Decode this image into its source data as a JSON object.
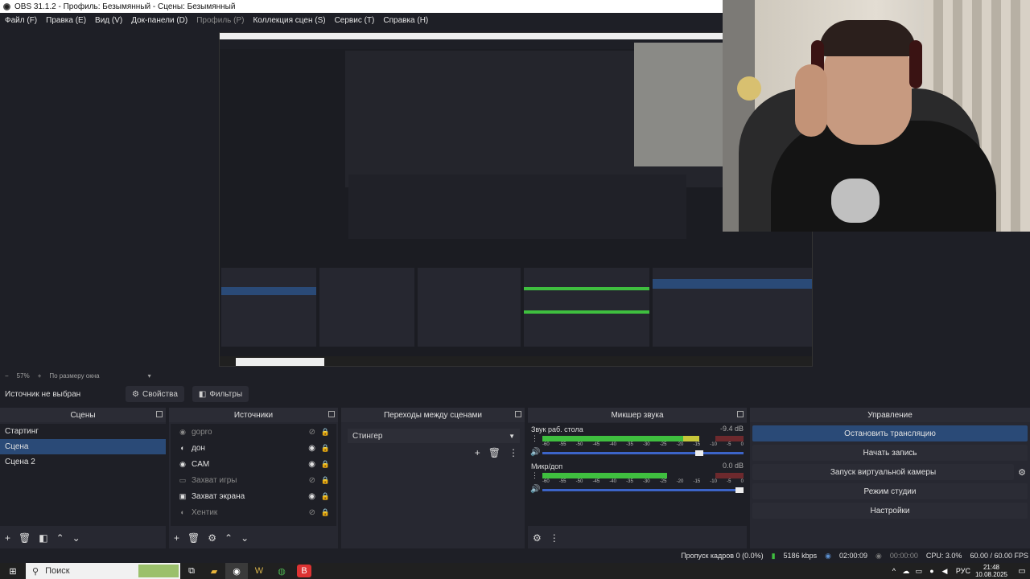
{
  "window": {
    "title": "OBS 31.1.2 - Профиль: Безымянный - Сцены: Безымянный"
  },
  "menu": [
    "Файл (F)",
    "Правка (E)",
    "Вид (V)",
    "Док-панели (D)",
    "Профиль (P)",
    "Коллекция сцен (S)",
    "Сервис (T)",
    "Справка (H)"
  ],
  "preview": {
    "zoom": "57%",
    "fit_label": "По размеру окна"
  },
  "context_bar": {
    "no_source": "Источник не выбран",
    "properties": "Свойства",
    "filters": "Фильтры"
  },
  "scenes": {
    "title": "Сцены",
    "items": [
      "Стартинг",
      "Сцена",
      "Сцена 2"
    ],
    "selected": 1
  },
  "sources": {
    "title": "Источники",
    "items": [
      {
        "name": "gopro",
        "icon": "camera-icon",
        "visible": false
      },
      {
        "name": "дон",
        "icon": "source-icon",
        "visible": true
      },
      {
        "name": "CAM",
        "icon": "camera-icon",
        "visible": true
      },
      {
        "name": "Захват игры",
        "icon": "gamepad-icon",
        "visible": false
      },
      {
        "name": "Захват экрана",
        "icon": "monitor-icon",
        "visible": true
      },
      {
        "name": "Хентик",
        "icon": "source-icon",
        "visible": false
      }
    ]
  },
  "transitions": {
    "title": "Переходы между сценами",
    "selected": "Стингер"
  },
  "mixer": {
    "title": "Микшер звука",
    "scale": [
      "-60",
      "-55",
      "-50",
      "-45",
      "-40",
      "-35",
      "-30",
      "-25",
      "-20",
      "-15",
      "-10",
      "-5",
      "0"
    ],
    "channels": [
      {
        "name": "Звук раб. стола",
        "db": "-9.4 dB",
        "level": 0.78,
        "fader": 0.8
      },
      {
        "name": "Микр/доп",
        "db": "0.0 dB",
        "level": 0.62,
        "fader": 1.0
      }
    ]
  },
  "controls": {
    "title": "Управление",
    "stop_stream": "Остановить трансляцию",
    "start_record": "Начать запись",
    "virtual_cam": "Запуск виртуальной камеры",
    "studio_mode": "Режим студии",
    "settings": "Настройки"
  },
  "status": {
    "dropped": "Пропуск кадров 0 (0.0%)",
    "kbps": "5186 kbps",
    "stream_time": "02:00:09",
    "rec_time": "00:00:00",
    "cpu": "CPU: 3.0%",
    "fps": "60.00 / 60.00 FPS"
  },
  "taskbar": {
    "search": "Поиск",
    "lang": "РУС",
    "time": "21:48",
    "date": "10.08.2025"
  },
  "colors": {
    "accent": "#2a4a77",
    "panel": "#272831",
    "bg": "#1e1f26"
  }
}
